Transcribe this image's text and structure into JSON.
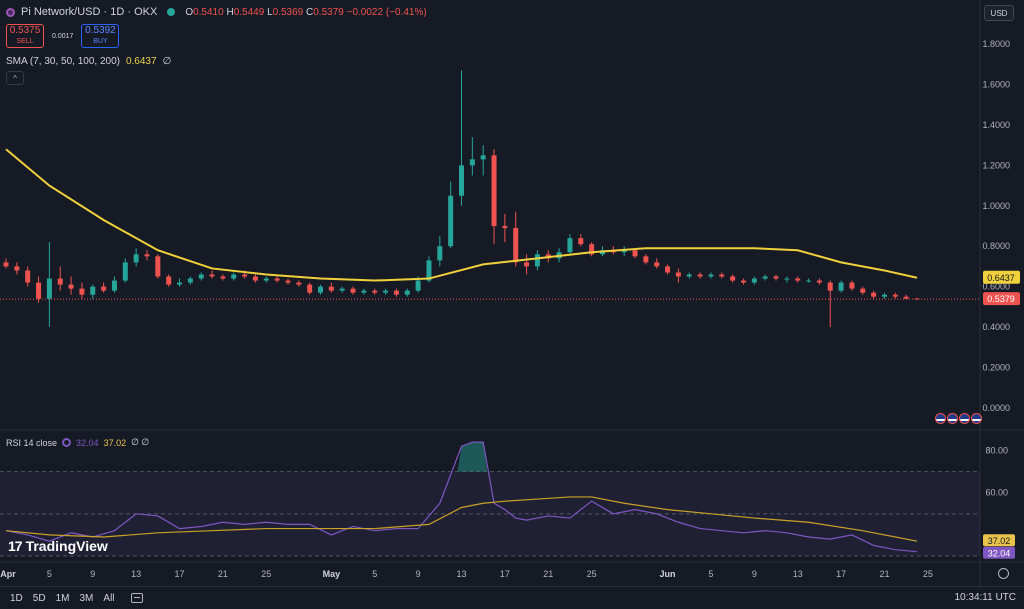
{
  "header": {
    "symbol_title": "Pi Network/USD · 1D · OKX",
    "ohlc": [
      {
        "k": "O",
        "v": "0.5410"
      },
      {
        "k": "H",
        "v": "0.5449"
      },
      {
        "k": "L",
        "v": "0.5369"
      },
      {
        "k": "C",
        "v": "0.5379"
      },
      {
        "k": "",
        "v": "−0.0022 (−0.41%)"
      }
    ],
    "sell_price": "0.5375",
    "sell_label": "SELL",
    "spread": "0.0017",
    "buy_price": "0.5392",
    "buy_label": "BUY",
    "sma_label": "SMA (7, 30, 50, 100, 200)",
    "sma_value": "0.6437",
    "sma_trail": "∅",
    "collapse_icon": "^",
    "currency": "USD"
  },
  "rsi_legend": {
    "label": "RSI 14 close",
    "rsi_value": "32.04",
    "ma_value": "37.02",
    "trail": "∅ ∅"
  },
  "branding": {
    "name": "TradingView",
    "mark": "17"
  },
  "bottom": {
    "ranges": [
      "1D",
      "5D",
      "1M",
      "3M",
      "All"
    ],
    "clock": "10:34:11 UTC"
  },
  "colors": {
    "up": "#26a69a",
    "down": "#ef5350",
    "sma": "#f0d13b",
    "rsi": "#7e57c2",
    "rsi_ma": "#c9a227",
    "background": "#161a25"
  },
  "chart_data": [
    {
      "type": "candlestick",
      "title": "Pi Network/USD · 1D · OKX",
      "y_axis_ticks": [
        "1.8000",
        "1.6000",
        "1.4000",
        "1.2000",
        "1.0000",
        "0.8000",
        "0.6000",
        "0.4000",
        "0.2000",
        "0.0000"
      ],
      "ylim": [
        -0.1,
        1.92
      ],
      "x_axis_ticks": [
        "Apr",
        "5",
        "9",
        "13",
        "17",
        "21",
        "25",
        "May",
        "5",
        "9",
        "13",
        "17",
        "21",
        "25",
        "Jun",
        "5",
        "9",
        "13",
        "17",
        "21",
        "25"
      ],
      "x_range_days": [
        1,
        86
      ],
      "last_price_label": "0.5379",
      "sma_price_label": "0.6437",
      "candles": [
        {
          "d": 1,
          "o": 0.72,
          "h": 0.74,
          "l": 0.69,
          "c": 0.7
        },
        {
          "d": 2,
          "o": 0.7,
          "h": 0.72,
          "l": 0.66,
          "c": 0.68
        },
        {
          "d": 3,
          "o": 0.68,
          "h": 0.7,
          "l": 0.6,
          "c": 0.62
        },
        {
          "d": 4,
          "o": 0.62,
          "h": 0.65,
          "l": 0.52,
          "c": 0.54
        },
        {
          "d": 5,
          "o": 0.54,
          "h": 0.82,
          "l": 0.4,
          "c": 0.64
        },
        {
          "d": 6,
          "o": 0.64,
          "h": 0.7,
          "l": 0.58,
          "c": 0.61
        },
        {
          "d": 7,
          "o": 0.61,
          "h": 0.65,
          "l": 0.56,
          "c": 0.59
        },
        {
          "d": 8,
          "o": 0.59,
          "h": 0.62,
          "l": 0.54,
          "c": 0.56
        },
        {
          "d": 9,
          "o": 0.56,
          "h": 0.61,
          "l": 0.54,
          "c": 0.6
        },
        {
          "d": 10,
          "o": 0.6,
          "h": 0.62,
          "l": 0.57,
          "c": 0.58
        },
        {
          "d": 11,
          "o": 0.58,
          "h": 0.65,
          "l": 0.57,
          "c": 0.63
        },
        {
          "d": 12,
          "o": 0.63,
          "h": 0.74,
          "l": 0.62,
          "c": 0.72
        },
        {
          "d": 13,
          "o": 0.72,
          "h": 0.79,
          "l": 0.7,
          "c": 0.76
        },
        {
          "d": 14,
          "o": 0.76,
          "h": 0.78,
          "l": 0.73,
          "c": 0.75
        },
        {
          "d": 15,
          "o": 0.75,
          "h": 0.76,
          "l": 0.64,
          "c": 0.65
        },
        {
          "d": 16,
          "o": 0.65,
          "h": 0.66,
          "l": 0.6,
          "c": 0.61
        },
        {
          "d": 17,
          "o": 0.61,
          "h": 0.64,
          "l": 0.6,
          "c": 0.62
        },
        {
          "d": 18,
          "o": 0.62,
          "h": 0.65,
          "l": 0.61,
          "c": 0.64
        },
        {
          "d": 19,
          "o": 0.64,
          "h": 0.67,
          "l": 0.63,
          "c": 0.66
        },
        {
          "d": 20,
          "o": 0.66,
          "h": 0.68,
          "l": 0.64,
          "c": 0.65
        },
        {
          "d": 21,
          "o": 0.65,
          "h": 0.66,
          "l": 0.63,
          "c": 0.64
        },
        {
          "d": 22,
          "o": 0.64,
          "h": 0.67,
          "l": 0.63,
          "c": 0.66
        },
        {
          "d": 23,
          "o": 0.66,
          "h": 0.68,
          "l": 0.64,
          "c": 0.65
        },
        {
          "d": 24,
          "o": 0.65,
          "h": 0.66,
          "l": 0.62,
          "c": 0.63
        },
        {
          "d": 25,
          "o": 0.63,
          "h": 0.65,
          "l": 0.62,
          "c": 0.64
        },
        {
          "d": 26,
          "o": 0.64,
          "h": 0.65,
          "l": 0.62,
          "c": 0.63
        },
        {
          "d": 27,
          "o": 0.63,
          "h": 0.64,
          "l": 0.61,
          "c": 0.62
        },
        {
          "d": 28,
          "o": 0.62,
          "h": 0.63,
          "l": 0.6,
          "c": 0.61
        },
        {
          "d": 29,
          "o": 0.61,
          "h": 0.62,
          "l": 0.56,
          "c": 0.57
        },
        {
          "d": 30,
          "o": 0.57,
          "h": 0.61,
          "l": 0.56,
          "c": 0.6
        },
        {
          "d": 31,
          "o": 0.6,
          "h": 0.62,
          "l": 0.57,
          "c": 0.58
        },
        {
          "d": 32,
          "o": 0.58,
          "h": 0.6,
          "l": 0.57,
          "c": 0.59
        },
        {
          "d": 33,
          "o": 0.59,
          "h": 0.6,
          "l": 0.56,
          "c": 0.57
        },
        {
          "d": 34,
          "o": 0.57,
          "h": 0.59,
          "l": 0.56,
          "c": 0.58
        },
        {
          "d": 35,
          "o": 0.58,
          "h": 0.59,
          "l": 0.56,
          "c": 0.57
        },
        {
          "d": 36,
          "o": 0.57,
          "h": 0.59,
          "l": 0.56,
          "c": 0.58
        },
        {
          "d": 37,
          "o": 0.58,
          "h": 0.59,
          "l": 0.55,
          "c": 0.56
        },
        {
          "d": 38,
          "o": 0.56,
          "h": 0.59,
          "l": 0.55,
          "c": 0.58
        },
        {
          "d": 39,
          "o": 0.58,
          "h": 0.65,
          "l": 0.57,
          "c": 0.63
        },
        {
          "d": 40,
          "o": 0.63,
          "h": 0.75,
          "l": 0.62,
          "c": 0.73
        },
        {
          "d": 41,
          "o": 0.73,
          "h": 0.85,
          "l": 0.7,
          "c": 0.8
        },
        {
          "d": 42,
          "o": 0.8,
          "h": 1.12,
          "l": 0.79,
          "c": 1.05
        },
        {
          "d": 43,
          "o": 1.05,
          "h": 1.67,
          "l": 1.0,
          "c": 1.2
        },
        {
          "d": 44,
          "o": 1.2,
          "h": 1.34,
          "l": 1.15,
          "c": 1.23
        },
        {
          "d": 45,
          "o": 1.23,
          "h": 1.3,
          "l": 1.15,
          "c": 1.25
        },
        {
          "d": 46,
          "o": 1.25,
          "h": 1.28,
          "l": 0.81,
          "c": 0.9
        },
        {
          "d": 47,
          "o": 0.9,
          "h": 0.96,
          "l": 0.82,
          "c": 0.89
        },
        {
          "d": 48,
          "o": 0.89,
          "h": 0.97,
          "l": 0.7,
          "c": 0.72
        },
        {
          "d": 49,
          "o": 0.72,
          "h": 0.76,
          "l": 0.66,
          "c": 0.7
        },
        {
          "d": 50,
          "o": 0.7,
          "h": 0.78,
          "l": 0.68,
          "c": 0.76
        },
        {
          "d": 51,
          "o": 0.76,
          "h": 0.78,
          "l": 0.72,
          "c": 0.74
        },
        {
          "d": 52,
          "o": 0.74,
          "h": 0.79,
          "l": 0.72,
          "c": 0.77
        },
        {
          "d": 53,
          "o": 0.77,
          "h": 0.86,
          "l": 0.76,
          "c": 0.84
        },
        {
          "d": 54,
          "o": 0.84,
          "h": 0.86,
          "l": 0.8,
          "c": 0.81
        },
        {
          "d": 55,
          "o": 0.81,
          "h": 0.82,
          "l": 0.75,
          "c": 0.76
        },
        {
          "d": 56,
          "o": 0.76,
          "h": 0.8,
          "l": 0.75,
          "c": 0.78
        },
        {
          "d": 57,
          "o": 0.78,
          "h": 0.8,
          "l": 0.76,
          "c": 0.77
        },
        {
          "d": 58,
          "o": 0.77,
          "h": 0.8,
          "l": 0.75,
          "c": 0.78
        },
        {
          "d": 59,
          "o": 0.78,
          "h": 0.79,
          "l": 0.74,
          "c": 0.75
        },
        {
          "d": 60,
          "o": 0.75,
          "h": 0.76,
          "l": 0.71,
          "c": 0.72
        },
        {
          "d": 61,
          "o": 0.72,
          "h": 0.74,
          "l": 0.69,
          "c": 0.7
        },
        {
          "d": 62,
          "o": 0.7,
          "h": 0.71,
          "l": 0.66,
          "c": 0.67
        },
        {
          "d": 63,
          "o": 0.67,
          "h": 0.69,
          "l": 0.62,
          "c": 0.65
        },
        {
          "d": 64,
          "o": 0.65,
          "h": 0.67,
          "l": 0.64,
          "c": 0.66
        },
        {
          "d": 65,
          "o": 0.66,
          "h": 0.67,
          "l": 0.64,
          "c": 0.65
        },
        {
          "d": 66,
          "o": 0.65,
          "h": 0.67,
          "l": 0.64,
          "c": 0.66
        },
        {
          "d": 67,
          "o": 0.66,
          "h": 0.67,
          "l": 0.64,
          "c": 0.65
        },
        {
          "d": 68,
          "o": 0.65,
          "h": 0.66,
          "l": 0.62,
          "c": 0.63
        },
        {
          "d": 69,
          "o": 0.63,
          "h": 0.64,
          "l": 0.61,
          "c": 0.62
        },
        {
          "d": 70,
          "o": 0.62,
          "h": 0.65,
          "l": 0.61,
          "c": 0.64
        },
        {
          "d": 71,
          "o": 0.64,
          "h": 0.66,
          "l": 0.63,
          "c": 0.65
        },
        {
          "d": 72,
          "o": 0.65,
          "h": 0.66,
          "l": 0.63,
          "c": 0.64
        },
        {
          "d": 73,
          "o": 0.64,
          "h": 0.65,
          "l": 0.62,
          "c": 0.64
        },
        {
          "d": 74,
          "o": 0.64,
          "h": 0.65,
          "l": 0.62,
          "c": 0.63
        },
        {
          "d": 75,
          "o": 0.63,
          "h": 0.64,
          "l": 0.62,
          "c": 0.63
        },
        {
          "d": 76,
          "o": 0.63,
          "h": 0.64,
          "l": 0.61,
          "c": 0.62
        },
        {
          "d": 77,
          "o": 0.62,
          "h": 0.63,
          "l": 0.4,
          "c": 0.58
        },
        {
          "d": 78,
          "o": 0.58,
          "h": 0.63,
          "l": 0.57,
          "c": 0.62
        },
        {
          "d": 79,
          "o": 0.62,
          "h": 0.63,
          "l": 0.58,
          "c": 0.59
        },
        {
          "d": 80,
          "o": 0.59,
          "h": 0.6,
          "l": 0.56,
          "c": 0.57
        },
        {
          "d": 81,
          "o": 0.57,
          "h": 0.58,
          "l": 0.54,
          "c": 0.55
        },
        {
          "d": 82,
          "o": 0.55,
          "h": 0.57,
          "l": 0.54,
          "c": 0.56
        },
        {
          "d": 83,
          "o": 0.56,
          "h": 0.57,
          "l": 0.54,
          "c": 0.55
        },
        {
          "d": 84,
          "o": 0.55,
          "h": 0.56,
          "l": 0.54,
          "c": 0.54
        },
        {
          "d": 85,
          "o": 0.541,
          "h": 0.5449,
          "l": 0.5369,
          "c": 0.5379
        }
      ],
      "series": [
        {
          "name": "SMA",
          "x": [
            1,
            5,
            10,
            15,
            20,
            25,
            30,
            35,
            40,
            45,
            50,
            55,
            60,
            65,
            70,
            74,
            78,
            82,
            85
          ],
          "values": [
            1.28,
            1.1,
            0.93,
            0.78,
            0.69,
            0.66,
            0.64,
            0.63,
            0.64,
            0.71,
            0.74,
            0.77,
            0.79,
            0.79,
            0.79,
            0.78,
            0.72,
            0.68,
            0.6437
          ]
        }
      ]
    },
    {
      "type": "line",
      "title": "RSI 14 close",
      "y_axis_ticks": [
        "80.00",
        "60.00"
      ],
      "ylim": [
        30,
        85
      ],
      "bands": [
        30,
        50,
        70
      ],
      "last_labels": [
        "37.02",
        "32.04"
      ],
      "series": [
        {
          "name": "RSI",
          "x": [
            1,
            3,
            5,
            7,
            9,
            11,
            13,
            15,
            17,
            19,
            21,
            23,
            25,
            27,
            29,
            31,
            33,
            35,
            37,
            39,
            41,
            43,
            44,
            45,
            46,
            47,
            48,
            49,
            51,
            53,
            55,
            57,
            59,
            61,
            63,
            65,
            67,
            69,
            71,
            73,
            75,
            77,
            79,
            81,
            83,
            85
          ],
          "values": [
            42,
            40,
            37,
            41,
            39,
            42,
            50,
            49,
            43,
            44,
            46,
            45,
            46,
            45,
            45,
            40,
            44,
            42,
            43,
            43,
            55,
            82,
            84,
            84,
            55,
            52,
            48,
            47,
            49,
            48,
            56,
            50,
            52,
            50,
            46,
            43,
            42,
            41,
            42,
            41,
            39,
            38,
            40,
            35,
            33,
            32.04
          ]
        },
        {
          "name": "RSI-based MA",
          "x": [
            1,
            5,
            10,
            15,
            20,
            25,
            30,
            35,
            40,
            43,
            45,
            47,
            50,
            53,
            55,
            58,
            62,
            66,
            70,
            75,
            80,
            85
          ],
          "values": [
            42,
            40,
            39,
            41,
            42,
            43,
            43,
            43,
            45,
            53,
            55,
            56,
            57,
            58,
            58,
            55,
            52,
            50,
            48,
            46,
            42,
            37.02
          ]
        }
      ]
    }
  ]
}
